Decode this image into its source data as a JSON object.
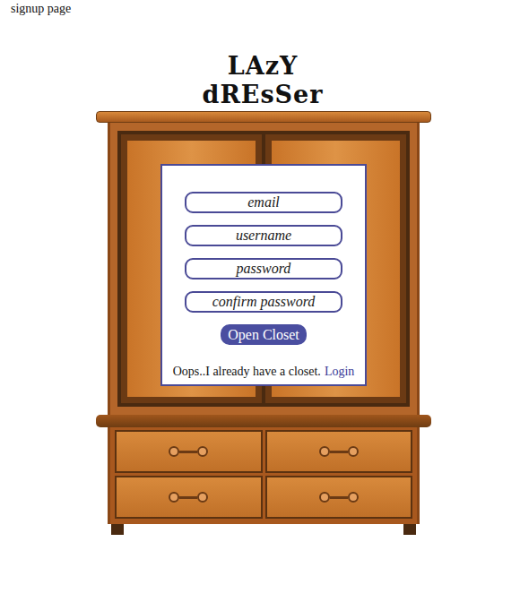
{
  "page_label": "signup page",
  "title": {
    "lines": [
      "LAzY",
      "dREsSer"
    ]
  },
  "form": {
    "fields": [
      {
        "placeholder": "email",
        "type": "email"
      },
      {
        "placeholder": "username",
        "type": "text"
      },
      {
        "placeholder": "password",
        "type": "password"
      },
      {
        "placeholder": "confirm password",
        "type": "password"
      }
    ],
    "submit": "Open Closet",
    "footer": {
      "text": "Oops..I already have a closet.",
      "link": "Login"
    }
  }
}
